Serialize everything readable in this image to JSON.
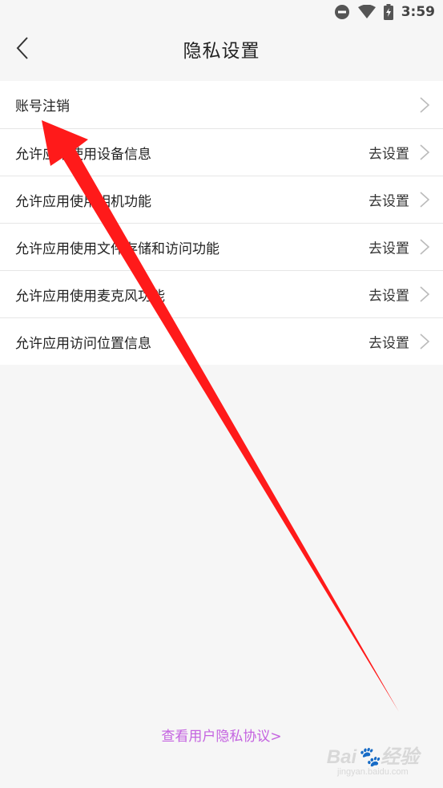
{
  "status_bar": {
    "time": "3:59",
    "icons": [
      "do-not-disturb-icon",
      "wifi-icon",
      "battery-charging-icon"
    ]
  },
  "header": {
    "back_icon": "chevron-left-icon",
    "title": "隐私设置"
  },
  "settings": {
    "items": [
      {
        "label": "账号注销",
        "action": ""
      },
      {
        "label": "允许应用使用设备信息",
        "action": "去设置"
      },
      {
        "label": "允许应用使用相机功能",
        "action": "去设置"
      },
      {
        "label": "允许应用使用文件存储和访问功能",
        "action": "去设置"
      },
      {
        "label": "允许应用使用麦克风功能",
        "action": "去设置"
      },
      {
        "label": "允许应用访问位置信息",
        "action": "去设置"
      }
    ]
  },
  "footer": {
    "privacy_link": "查看用户隐私协议>"
  },
  "watermark": {
    "logo": "Bai🐾经验",
    "sub": "jingyan.baidu.com"
  },
  "colors": {
    "accent_link": "#c463e0",
    "annotation_arrow": "#ff1a1a",
    "page_background": "#f6f6f6"
  }
}
